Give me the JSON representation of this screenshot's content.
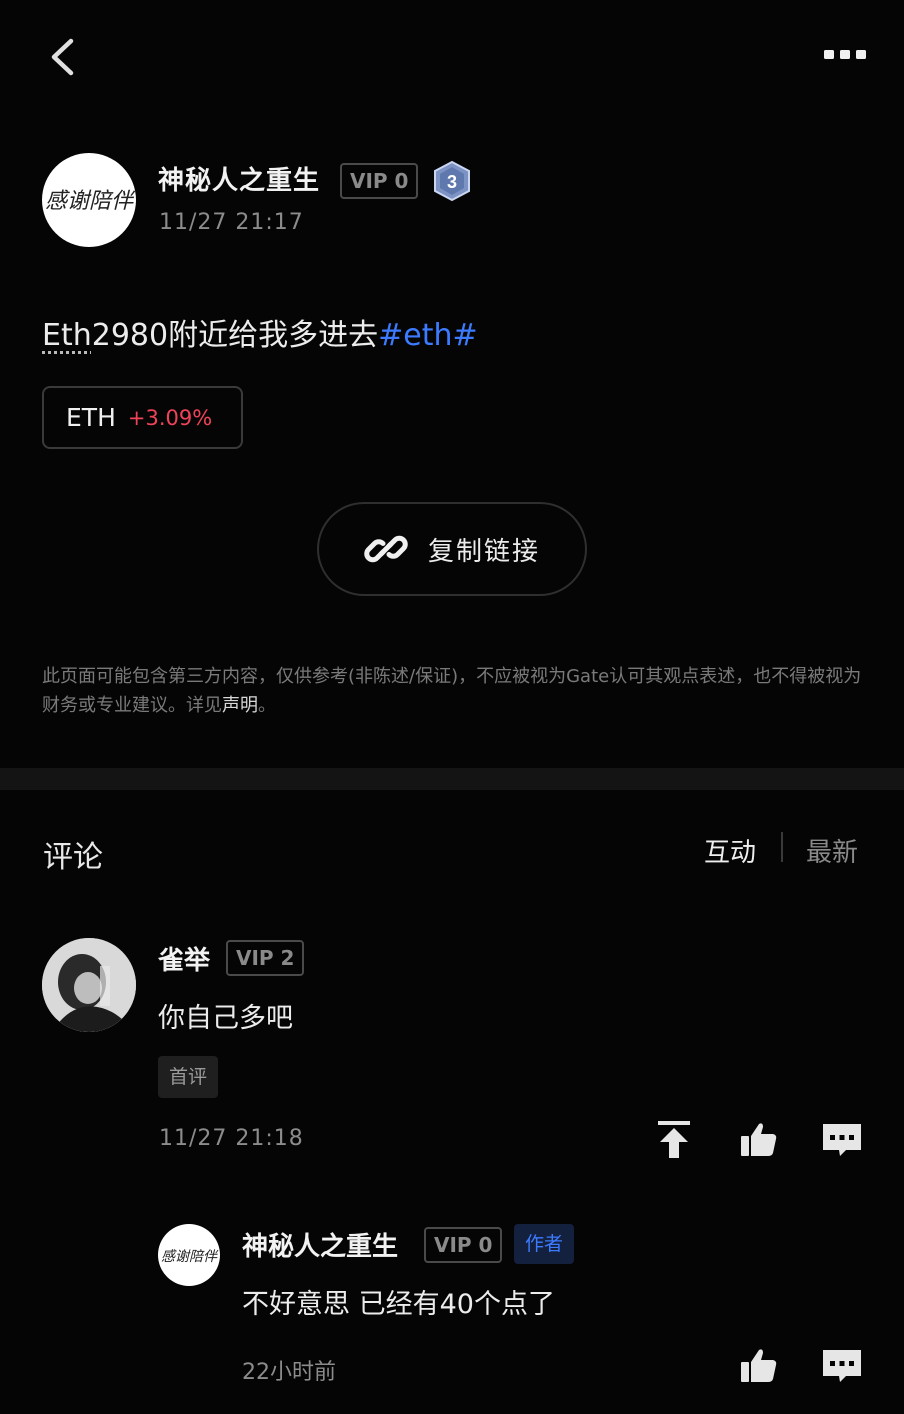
{
  "nav": {
    "back_icon": "chevron-left-icon",
    "more_icon": "more-dots-icon"
  },
  "post": {
    "author": "神秘人之重生",
    "vip": "VIP 0",
    "level": "3",
    "time": "11/27 21:17",
    "content_prefix": "Eth",
    "content_main": "2980附近给我多进去",
    "hashtag": "#eth#",
    "avatar_text": "感谢陪伴",
    "coin": {
      "symbol": "ETH",
      "change": "+3.09%"
    },
    "copy_link_label": "复制链接",
    "disclaimer": "此页面可能包含第三方内容，仅供参考(非陈述/保证)，不应被视为Gate认可其观点表述，也不得被视为财务或专业建议。详见",
    "disclaimer_link": "声明",
    "disclaimer_end": "。"
  },
  "comments": {
    "title": "评论",
    "sort_interact": "互动",
    "sort_latest": "最新",
    "items": [
      {
        "name": "雀举",
        "vip": "VIP 2",
        "text": "你自己多吧",
        "tag": "首评",
        "time": "11/27 21:18"
      }
    ],
    "reply": {
      "name": "神秘人之重生",
      "vip": "VIP 0",
      "tag": "作者",
      "text": "不好意思 已经有40个点了",
      "time": "22小时前"
    }
  },
  "colors": {
    "background": "#050505",
    "hashtag": "#3c7bff",
    "price_up": "#f0435a",
    "author_tag_bg": "#13213f"
  }
}
